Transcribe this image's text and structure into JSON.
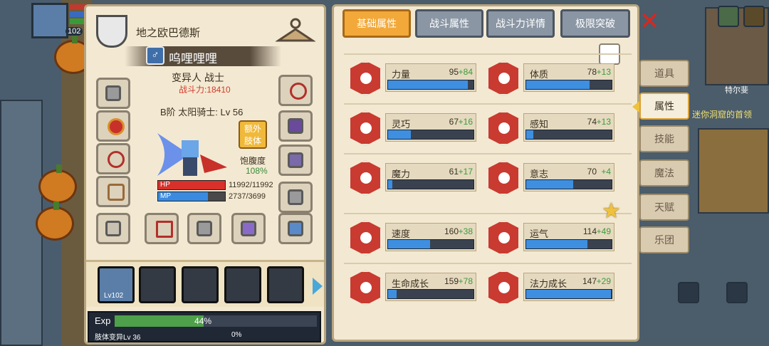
{
  "hud": {
    "level": "102"
  },
  "character": {
    "guild_name": "地之欧巴德斯",
    "name": "呜哩哩哩",
    "class_line": "变异人 战士",
    "power": "战斗力:18410",
    "rank_line": "B阶 太阳骑士: Lv 56",
    "extra_button": "额外\n肢体",
    "satiety_label": "饱腹度",
    "satiety_value": "108%",
    "hp_label": "HP",
    "hp_value": "11992/11992",
    "hp_fraction": 1.0,
    "mp_label": "MP",
    "mp_value": "2737/3699",
    "mp_fraction": 0.74
  },
  "party": {
    "first_level": "Lv102"
  },
  "exp": {
    "label": "Exp",
    "percent": "44%",
    "fraction": 0.44,
    "mutation_label": "肢体变异Lv 36",
    "mutation_percent": "0%"
  },
  "tabs": [
    "基础属性",
    "战斗属性",
    "战斗力详情",
    "极限突破"
  ],
  "stats": [
    {
      "name": "力量",
      "value": "95",
      "bonus": "+84",
      "fill": 0.93,
      "icon": "strength-icon"
    },
    {
      "name": "体质",
      "value": "78",
      "bonus": "+13",
      "fill": 0.74,
      "icon": "constitution-icon"
    },
    {
      "name": "灵巧",
      "value": "67",
      "bonus": "+16",
      "fill": 0.27,
      "icon": "agility-icon"
    },
    {
      "name": "感知",
      "value": "74",
      "bonus": "+13",
      "fill": 0.08,
      "icon": "perception-icon"
    },
    {
      "name": "魔力",
      "value": "61",
      "bonus": "+17",
      "fill": 0.05,
      "icon": "magic-icon"
    },
    {
      "name": "意志",
      "value": "70",
      "bonus": "+4",
      "fill": 0.55,
      "icon": "willpower-icon"
    },
    {
      "name": "速度",
      "value": "160",
      "bonus": "+38",
      "fill": 0.49,
      "icon": "speed-icon"
    },
    {
      "name": "运气",
      "value": "114",
      "bonus": "+49",
      "fill": 0.72,
      "icon": "luck-icon"
    },
    {
      "name": "生命成长",
      "value": "159",
      "bonus": "+78",
      "fill": 0.1,
      "icon": "life-growth-icon"
    },
    {
      "name": "法力成长",
      "value": "147",
      "bonus": "+29",
      "fill": 0.99,
      "icon": "mana-growth-icon"
    }
  ],
  "side_menu": [
    "道具",
    "属性",
    "技能",
    "魔法",
    "天赋",
    "乐团"
  ],
  "map": {
    "town": "特尔斐",
    "quest": "迷你洞窟的首领"
  },
  "colors": {
    "accent": "#f2a93a",
    "stat_bar": "#3f8fe0",
    "bonus": "#3f9a3a",
    "power": "#d33a2a"
  }
}
